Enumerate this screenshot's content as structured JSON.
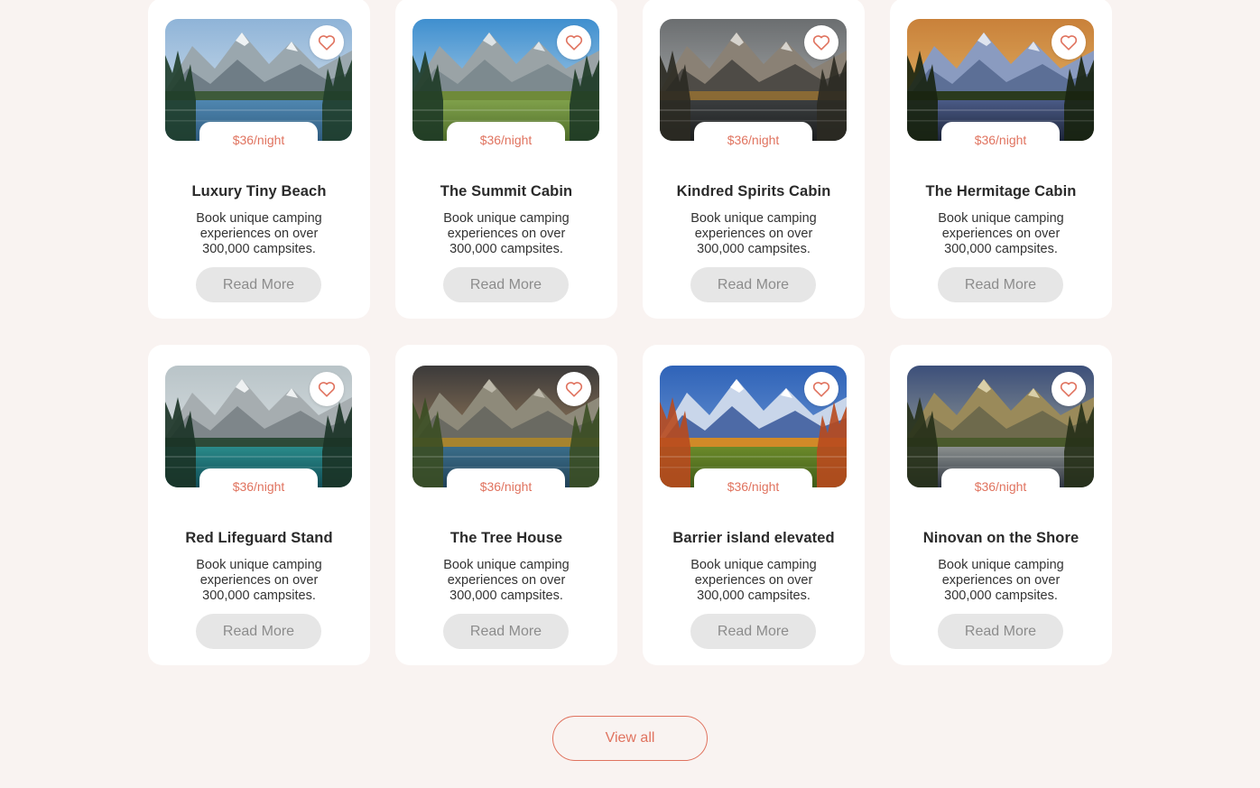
{
  "colors": {
    "accent": "#e0735f",
    "page_bg": "#f9f3f1",
    "button_bg": "#e6e6e6"
  },
  "cards": [
    {
      "title": "Luxury Tiny Beach",
      "price": "$36/night",
      "desc": "Book unique camping experiences on over 300,000 campsites.",
      "button": "Read More",
      "scene": "lake-mountains"
    },
    {
      "title": "The Summit Cabin",
      "price": "$36/night",
      "desc": "Book unique camping experiences on over 300,000 campsites.",
      "button": "Read More",
      "scene": "forest-sky"
    },
    {
      "title": "Kindred Spirits Cabin",
      "price": "$36/night",
      "desc": "Book unique camping experiences on over 300,000 campsites.",
      "button": "Read More",
      "scene": "mountain-reflection"
    },
    {
      "title": "The Hermitage Cabin",
      "price": "$36/night",
      "desc": "Book unique camping experiences on over 300,000 campsites.",
      "button": "Read More",
      "scene": "sunset-lake"
    },
    {
      "title": "Red Lifeguard Stand",
      "price": "$36/night",
      "desc": "Book unique camping experiences on over 300,000 campsites.",
      "button": "Read More",
      "scene": "teal-lake"
    },
    {
      "title": "The Tree House",
      "price": "$36/night",
      "desc": "Book unique camping experiences on over 300,000 campsites.",
      "button": "Read More",
      "scene": "autumn-valley"
    },
    {
      "title": "Barrier island elevated",
      "price": "$36/night",
      "desc": "Book unique camping experiences on over 300,000 campsites.",
      "button": "Read More",
      "scene": "snow-peak-autumn"
    },
    {
      "title": "Ninovan on the Shore",
      "price": "$36/night",
      "desc": "Book unique camping experiences on over 300,000 campsites.",
      "button": "Read More",
      "scene": "rocky-shore"
    }
  ],
  "view_all_label": "View all"
}
